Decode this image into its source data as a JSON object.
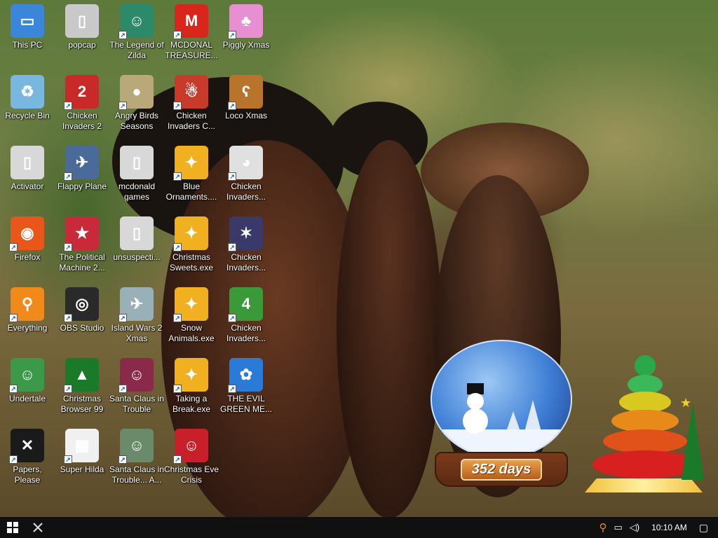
{
  "desktop": {
    "icons": [
      {
        "label": "This PC",
        "icon": "this-pc-icon",
        "color": "#3b86d8",
        "glyph": "▭",
        "shortcut": false
      },
      {
        "label": "popcap",
        "icon": "folder-icon",
        "color": "#c9c9c9",
        "glyph": "▯",
        "shortcut": false
      },
      {
        "label": "The Legend of Zilda",
        "icon": "game-icon",
        "color": "#2c8a6a",
        "glyph": "☺",
        "shortcut": true
      },
      {
        "label": "MCDONAL TREASURE...",
        "icon": "mcdonalds-icon",
        "color": "#d8261c",
        "glyph": "M",
        "shortcut": true
      },
      {
        "label": "Piggly Xmas",
        "icon": "pig-icon",
        "color": "#e88fd2",
        "glyph": "♣",
        "shortcut": true
      },
      {
        "label": "Recycle Bin",
        "icon": "recycle-bin-icon",
        "color": "#78b8e0",
        "glyph": "♻",
        "shortcut": false
      },
      {
        "label": "Chicken Invaders 2",
        "icon": "chicken-icon",
        "color": "#c82a2a",
        "glyph": "2",
        "shortcut": true
      },
      {
        "label": "Angry Birds Seasons",
        "icon": "angry-birds-icon",
        "color": "#b8a87a",
        "glyph": "●",
        "shortcut": true
      },
      {
        "label": "Chicken Invaders C...",
        "icon": "chicken-icon",
        "color": "#c83a2a",
        "glyph": "☃",
        "shortcut": true
      },
      {
        "label": "Loco Xmas",
        "icon": "bear-icon",
        "color": "#b8742a",
        "glyph": "ʕ",
        "shortcut": true
      },
      {
        "label": "Activator",
        "icon": "file-icon",
        "color": "#d8d8d8",
        "glyph": "▯",
        "shortcut": false
      },
      {
        "label": "Flappy Plane",
        "icon": "game-icon",
        "color": "#4a6a9a",
        "glyph": "✈",
        "shortcut": true
      },
      {
        "label": "mcdonald games",
        "icon": "folder-icon",
        "color": "#d8d8d8",
        "glyph": "▯",
        "shortcut": false
      },
      {
        "label": "Blue Ornaments....",
        "icon": "puzzle-icon",
        "color": "#f0b020",
        "glyph": "✦",
        "shortcut": true
      },
      {
        "label": "Chicken Invaders...",
        "icon": "chicken-icon",
        "color": "#e0e0e0",
        "glyph": "◕",
        "shortcut": true
      },
      {
        "label": "Firefox",
        "icon": "firefox-icon",
        "color": "#e8561a",
        "glyph": "◉",
        "shortcut": true
      },
      {
        "label": "The Political Machine 2...",
        "icon": "political-icon",
        "color": "#c82a3a",
        "glyph": "★",
        "shortcut": true
      },
      {
        "label": "unsuspecti...",
        "icon": "file-icon",
        "color": "#d8d8d8",
        "glyph": "▯",
        "shortcut": false
      },
      {
        "label": "Christmas Sweets.exe",
        "icon": "puzzle-icon",
        "color": "#f0b020",
        "glyph": "✦",
        "shortcut": true
      },
      {
        "label": "Chicken Invaders...",
        "icon": "chicken-icon",
        "color": "#3a3a6a",
        "glyph": "✶",
        "shortcut": true
      },
      {
        "label": "Everything",
        "icon": "search-icon",
        "color": "#f08a1a",
        "glyph": "⚲",
        "shortcut": true
      },
      {
        "label": "OBS Studio",
        "icon": "obs-icon",
        "color": "#2a2a2a",
        "glyph": "◎",
        "shortcut": true
      },
      {
        "label": "Island Wars 2 Xmas",
        "icon": "game-icon",
        "color": "#9ab0b8",
        "glyph": "✈",
        "shortcut": true
      },
      {
        "label": "Snow Animals.exe",
        "icon": "puzzle-icon",
        "color": "#f0b020",
        "glyph": "✦",
        "shortcut": true
      },
      {
        "label": "Chicken Invaders...",
        "icon": "chicken-icon",
        "color": "#3a9a3a",
        "glyph": "4",
        "shortcut": true
      },
      {
        "label": "Undertale",
        "icon": "undertale-icon",
        "color": "#3a9a4a",
        "glyph": "☺",
        "shortcut": true
      },
      {
        "label": "Christmas Browser 99",
        "icon": "christmas-tree-icon",
        "color": "#1a7a2a",
        "glyph": "▲",
        "shortcut": true
      },
      {
        "label": "Santa Claus in Trouble",
        "icon": "santa-icon",
        "color": "#8a2a4a",
        "glyph": "☺",
        "shortcut": true
      },
      {
        "label": "Taking a Break.exe",
        "icon": "puzzle-icon",
        "color": "#f0b020",
        "glyph": "✦",
        "shortcut": true
      },
      {
        "label": "THE EVIL GREEN ME...",
        "icon": "msn-icon",
        "color": "#2a7ad8",
        "glyph": "✿",
        "shortcut": true
      },
      {
        "label": "Papers, Please",
        "icon": "papers-please-icon",
        "color": "#1a1a1a",
        "glyph": "✕",
        "shortcut": true
      },
      {
        "label": "Super Hilda",
        "icon": "pixel-icon",
        "color": "#f0f0f0",
        "glyph": "▦",
        "shortcut": true
      },
      {
        "label": "Santa Claus in Trouble... A...",
        "icon": "santa-icon",
        "color": "#6a8a6a",
        "glyph": "☺",
        "shortcut": true
      },
      {
        "label": "Christmas Eve Crisis",
        "icon": "santa-icon",
        "color": "#c8202a",
        "glyph": "☺",
        "shortcut": true
      }
    ]
  },
  "gadgets": {
    "countdown_days": "352 days"
  },
  "taskbar": {
    "start_icon": "windows-start-icon",
    "tools_icon": "tools-icon",
    "tray": {
      "search": "search-tray-icon",
      "network": "network-icon",
      "volume": "volume-icon",
      "clock": "10:10 AM",
      "notifications": "notification-icon"
    }
  }
}
